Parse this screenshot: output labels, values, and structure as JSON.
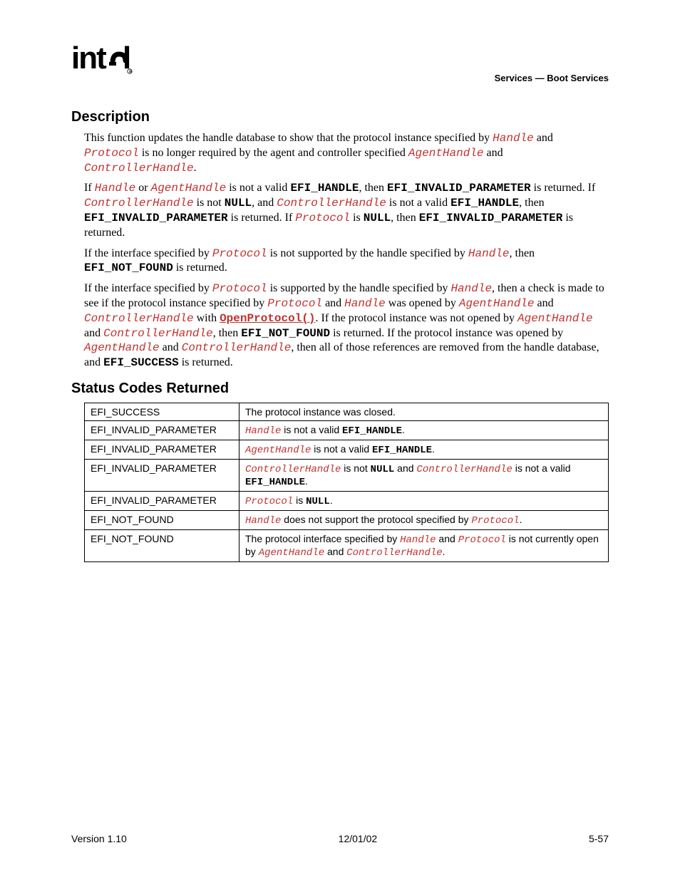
{
  "header": {
    "logo_text": "intel",
    "section": "Services — Boot Services"
  },
  "sections": {
    "description_title": "Description",
    "status_title": "Status Codes Returned"
  },
  "text": {
    "p1a": "This function updates the handle database to show that the protocol instance specified by ",
    "Handle": "Handle",
    "p1b": " and ",
    "Protocol": "Protocol",
    "p1c": " is no longer required by the agent and controller specified ",
    "AgentHandle": "AgentHandle",
    "p1d": " and ",
    "ControllerHandle": "ControllerHandle",
    "p1e": ".",
    "p2a": "If ",
    "p2b": " or ",
    "p2c": " is not a valid ",
    "EFI_HANDLE": "EFI_HANDLE",
    "p2d": ", then ",
    "EFI_INVALID_PARAMETER": "EFI_INVALID_PARAMETER",
    "p2e": " is returned.  If ",
    "p2f": " is not ",
    "NULL": "NULL",
    "p2g": ", and ",
    "p2h": " is not a valid ",
    "p2i": ", then ",
    "p2j": " is returned.  If ",
    "p2k": " is ",
    "p2l": ", then ",
    "p2m": " is returned.",
    "p3a": "If the interface specified by ",
    "p3b": " is not supported by the handle specified by ",
    "p3c": ", then ",
    "EFI_NOT_FOUND": "EFI_NOT_FOUND",
    "p3d": " is returned.",
    "p4a": "If the interface specified by ",
    "p4b": " is supported by the handle specified by ",
    "p4c": ", then a check is made to see if the protocol instance specified by ",
    "p4d": " and ",
    "p4e": " was opened by ",
    "p4f": " and ",
    "p4g": " with ",
    "OpenProtocol": "OpenProtocol()",
    "p4h": ".  If the protocol instance was not opened by ",
    "p4i": " and ",
    "p4j": ", then ",
    "p4k": " is returned.  If the protocol instance was opened by ",
    "p4l": " and ",
    "p4m": ", then all of those references are removed from the handle database, and ",
    "EFI_SUCCESS": "EFI_SUCCESS",
    "p4n": " is returned."
  },
  "table": {
    "rows": [
      {
        "code": "EFI_SUCCESS",
        "desc_plain": "The protocol instance was closed."
      },
      {
        "code": "EFI_INVALID_PARAMETER",
        "desc_pre": "",
        "param1": "Handle",
        "desc_mid": " is not a valid ",
        "const1": "EFI_HANDLE",
        "desc_post": "."
      },
      {
        "code": "EFI_INVALID_PARAMETER",
        "desc_pre": "",
        "param1": "AgentHandle",
        "desc_mid": " is not a valid ",
        "const1": "EFI_HANDLE",
        "desc_post": "."
      },
      {
        "code": "EFI_INVALID_PARAMETER",
        "r4a": "",
        "r4p1": "ControllerHandle",
        "r4b": " is not ",
        "r4c1": "NULL",
        "r4c": " and ",
        "r4p2": "ControllerHandle",
        "r4d": " is not a valid ",
        "r4c2": "EFI_HANDLE",
        "r4e": "."
      },
      {
        "code": "EFI_INVALID_PARAMETER",
        "param1": "Protocol",
        "desc_mid": " is ",
        "const1": "NULL",
        "desc_post": "."
      },
      {
        "code": "EFI_NOT_FOUND",
        "param1": "Handle",
        "r6a": " does not support the protocol specified by ",
        "param2": "Protocol",
        "desc_post": "."
      },
      {
        "code": "EFI_NOT_FOUND",
        "r7a": "The protocol interface specified by ",
        "param1": "Handle",
        "r7b": " and ",
        "param2": "Protocol",
        "r7c": " is not currently open by ",
        "param3": "AgentHandle",
        "r7d": " and ",
        "param4": "ControllerHandle",
        "desc_post": "."
      }
    ]
  },
  "footer": {
    "version": "Version 1.10",
    "date": "12/01/02",
    "page": "5-57"
  }
}
